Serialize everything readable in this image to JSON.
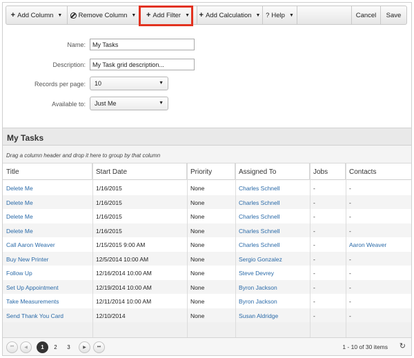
{
  "toolbar": {
    "add_column": "Add Column",
    "remove_column": "Remove Column",
    "add_filter": "Add Filter",
    "add_calculation": "Add Calculation",
    "help": "Help",
    "cancel": "Cancel",
    "save": "Save",
    "plus_glyph": "+",
    "help_glyph": "?",
    "caret_glyph": "▼"
  },
  "form": {
    "name_label": "Name:",
    "name_value": "My Tasks",
    "description_label": "Description:",
    "description_value": "My Task grid description...",
    "records_label": "Records per page:",
    "records_value": "10",
    "available_label": "Available to:",
    "available_value": "Just Me"
  },
  "grid": {
    "title": "My Tasks",
    "group_hint": "Drag a column header and drop it here to group by that column",
    "columns": [
      "Title",
      "Start Date",
      "Priority",
      "Assigned To",
      "Jobs",
      "Contacts"
    ],
    "rows": [
      {
        "title": "Delete Me",
        "start": "1/16/2015",
        "priority": "None",
        "assigned": "Charles Schnell",
        "jobs": "-",
        "contacts": "-"
      },
      {
        "title": "Delete Me",
        "start": "1/16/2015",
        "priority": "None",
        "assigned": "Charles Schnell",
        "jobs": "-",
        "contacts": "-"
      },
      {
        "title": "Delete Me",
        "start": "1/16/2015",
        "priority": "None",
        "assigned": "Charles Schnell",
        "jobs": "-",
        "contacts": "-"
      },
      {
        "title": "Delete Me",
        "start": "1/16/2015",
        "priority": "None",
        "assigned": "Charles Schnell",
        "jobs": "-",
        "contacts": "-"
      },
      {
        "title": "Call Aaron Weaver",
        "start": "1/15/2015 9:00 AM",
        "priority": "None",
        "assigned": "Charles Schnell",
        "jobs": "-",
        "contacts": "Aaron Weaver"
      },
      {
        "title": "Buy New Printer",
        "start": "12/5/2014 10:00 AM",
        "priority": "None",
        "assigned": "Sergio Gonzalez",
        "jobs": "-",
        "contacts": "-"
      },
      {
        "title": "Follow Up",
        "start": "12/16/2014 10:00 AM",
        "priority": "None",
        "assigned": "Steve Devrey",
        "jobs": "-",
        "contacts": "-"
      },
      {
        "title": "Set Up Appointment",
        "start": "12/19/2014 10:00 AM",
        "priority": "None",
        "assigned": "Byron Jackson",
        "jobs": "-",
        "contacts": "-"
      },
      {
        "title": "Take Measurements",
        "start": "12/11/2014 10:00 AM",
        "priority": "None",
        "assigned": "Byron Jackson",
        "jobs": "-",
        "contacts": "-"
      },
      {
        "title": "Send Thank You Card",
        "start": "12/10/2014",
        "priority": "None",
        "assigned": "Susan Aldridge",
        "jobs": "-",
        "contacts": "-"
      }
    ]
  },
  "pager": {
    "pages": [
      "1",
      "2",
      "3"
    ],
    "current_page": "1",
    "info": "1 - 10 of 30 items",
    "first_glyph": "⏮",
    "prev_glyph": "◀",
    "next_glyph": "▶",
    "last_glyph": "⏭",
    "refresh_glyph": "↻"
  }
}
